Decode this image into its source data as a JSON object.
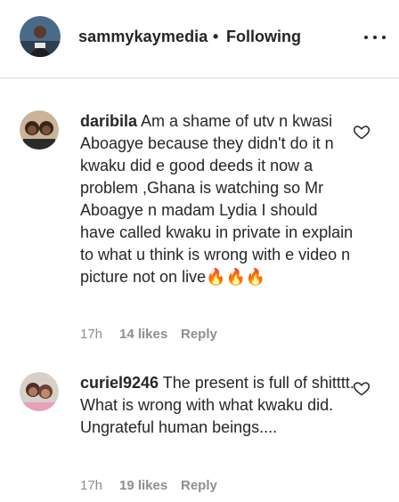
{
  "header": {
    "username": "sammykaymedia",
    "separator": "•",
    "follow_status": "Following",
    "more_icon": "more-horizontal-icon"
  },
  "comments": [
    {
      "username": "daribila",
      "text": "Am a shame of utv n kwasi Aboagye because they didn't do it n kwaku did e good deeds it now a problem ,Ghana is watching so Mr Aboagye n madam Lydia I should have called kwaku in private in explain to what u think is wrong with e video n picture not on live🔥🔥🔥",
      "time": "17h",
      "likes": "14 likes",
      "reply": "Reply"
    },
    {
      "username": "curiel9246",
      "text": "The present is full of shitttt. What is wrong with what kwaku did. Ungrateful human beings....",
      "time": "17h",
      "likes": "19 likes",
      "reply": "Reply"
    }
  ],
  "colors": {
    "text": "#262626",
    "secondary": "#8e8e8e",
    "divider": "#dbdbdb"
  }
}
